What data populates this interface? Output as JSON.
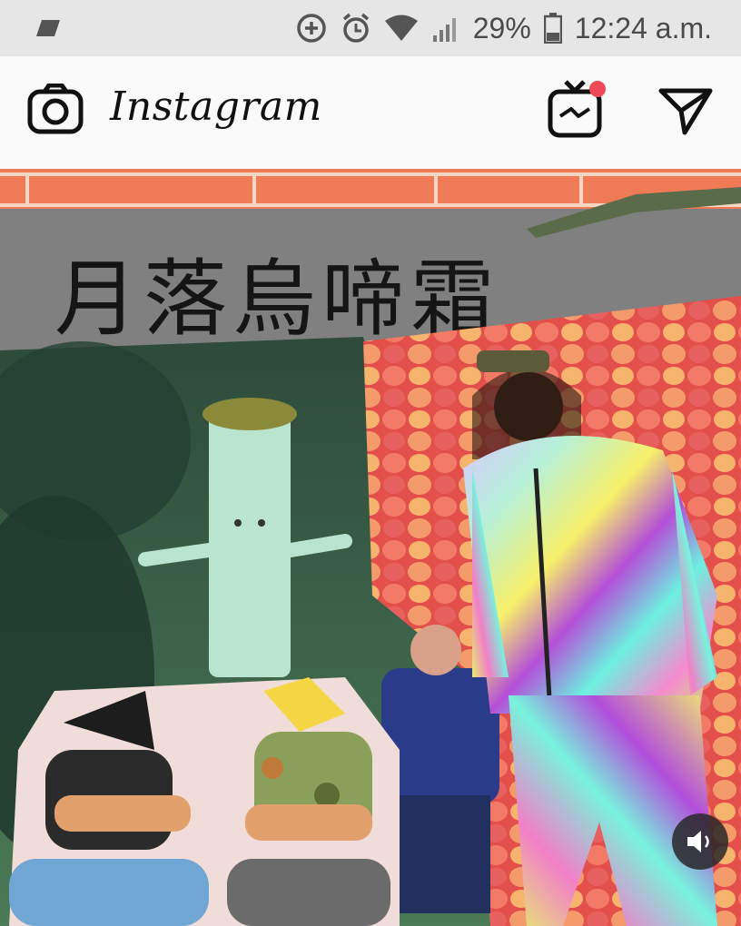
{
  "status_bar": {
    "battery_percent": "29%",
    "time": "12:24 a.m.",
    "icons": [
      "notification-icon",
      "data-saver-icon",
      "alarm-icon",
      "wifi-icon",
      "signal-icon",
      "battery-icon"
    ]
  },
  "header": {
    "app_name": "Instagram",
    "icons": [
      "camera-icon",
      "igtv-icon",
      "direct-message-icon"
    ],
    "igtv_has_notification": true
  },
  "post": {
    "image_description_icons": [
      "audio-mute-icon"
    ],
    "sign_text": "月落烏啼霜"
  },
  "colors": {
    "statusbar_bg": "#e6e6e6",
    "header_bg": "#fafafa",
    "notification_dot": "#ed4956"
  }
}
